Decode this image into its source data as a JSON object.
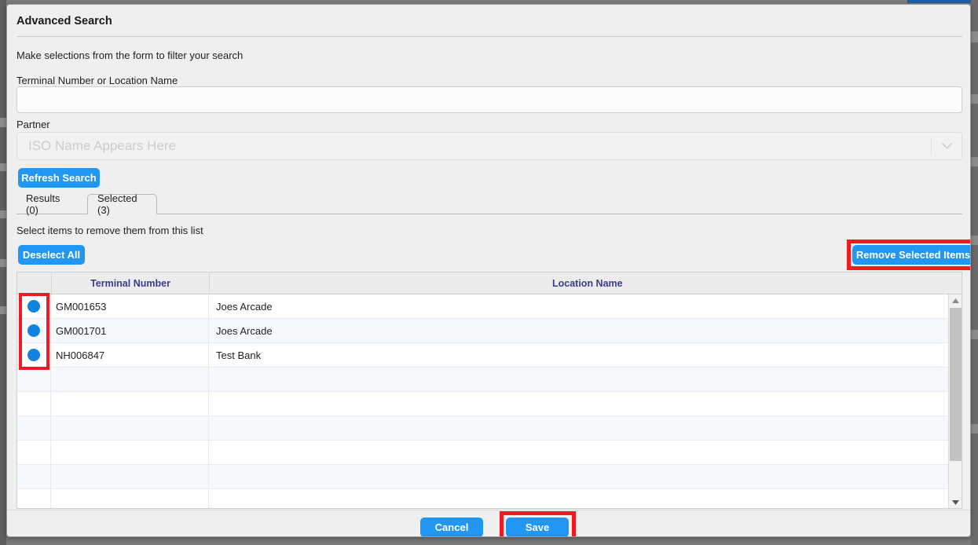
{
  "modal": {
    "title": "Advanced Search",
    "hint": "Make selections from the form to filter your search",
    "sub_hint": "Select items to remove them from this list"
  },
  "form": {
    "terminal_label": "Terminal Number or Location Name",
    "terminal_value": "",
    "terminal_placeholder": "",
    "partner_label": "Partner",
    "partner_placeholder": "ISO Name Appears Here",
    "partner_chevron_icon": "chevron-down-icon"
  },
  "buttons": {
    "refresh": "Refresh Search",
    "deselect_all": "Deselect All",
    "remove_selected": "Remove Selected Items",
    "cancel": "Cancel",
    "save": "Save"
  },
  "tabs": [
    {
      "label": "Results (0)",
      "active": false
    },
    {
      "label": "Selected (3)",
      "active": true
    }
  ],
  "table": {
    "columns": [
      "",
      "Terminal Number",
      "Location Name"
    ],
    "rows": [
      {
        "selected": true,
        "terminal": "GM001653",
        "location": "Joes Arcade"
      },
      {
        "selected": true,
        "terminal": "GM001701",
        "location": "Joes Arcade"
      },
      {
        "selected": true,
        "terminal": "NH006847",
        "location": "Test Bank"
      },
      {
        "selected": false,
        "terminal": "",
        "location": ""
      },
      {
        "selected": false,
        "terminal": "",
        "location": ""
      },
      {
        "selected": false,
        "terminal": "",
        "location": ""
      },
      {
        "selected": false,
        "terminal": "",
        "location": ""
      },
      {
        "selected": false,
        "terminal": "",
        "location": ""
      },
      {
        "selected": false,
        "terminal": "",
        "location": ""
      }
    ]
  },
  "scrollbar": {
    "up_icon": "scroll-up-arrow-icon",
    "down_icon": "scroll-down-arrow-icon"
  },
  "colors": {
    "accent_blue": "#2196f3",
    "radio_blue": "#1383e0",
    "annotation_red": "#ee1b24",
    "header_text_blue": "#3b3b8f",
    "modal_bg": "#efefef",
    "row_alt": "#f5f8fd"
  }
}
